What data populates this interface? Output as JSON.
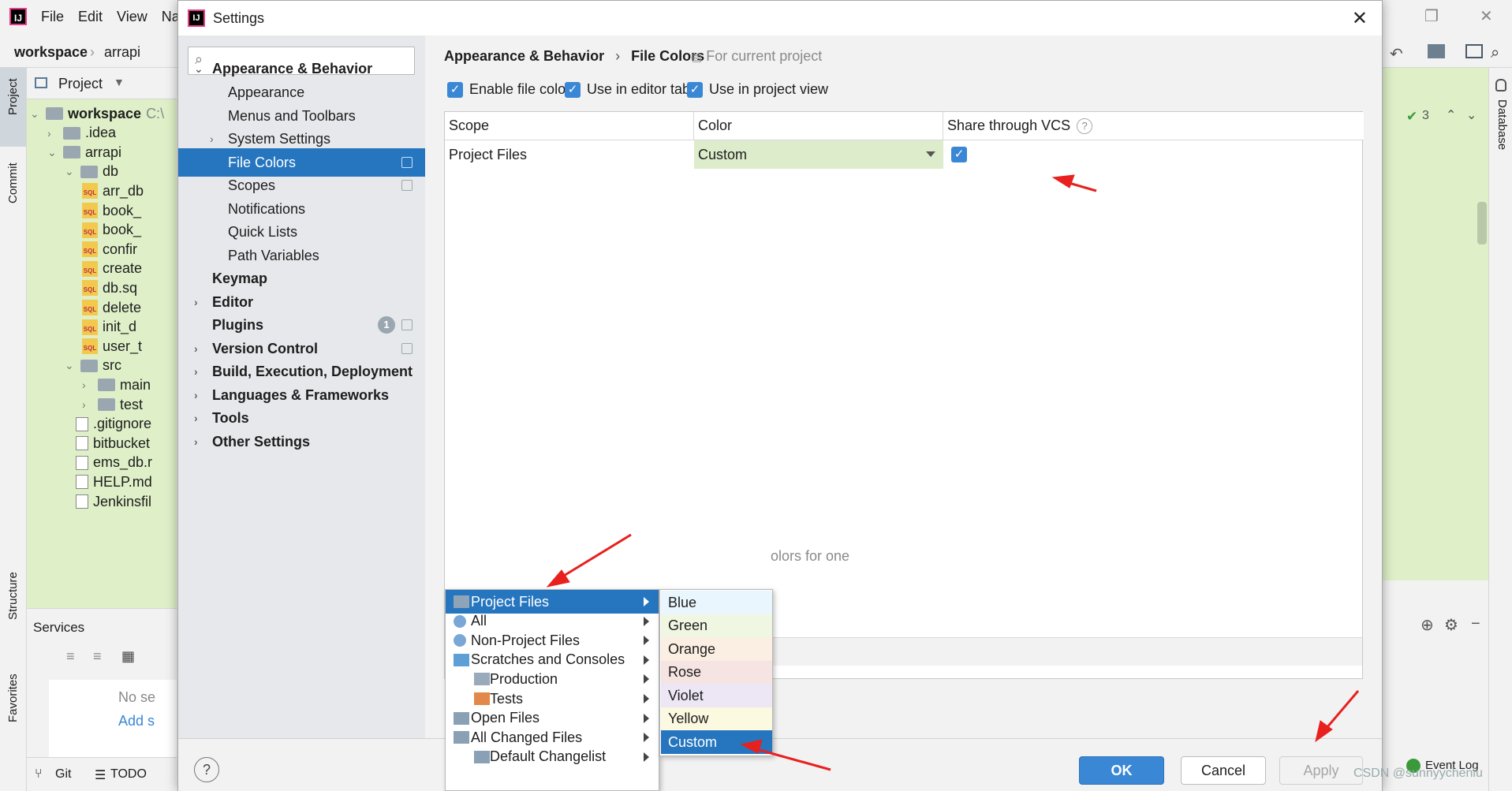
{
  "ide": {
    "menu": [
      "File",
      "Edit",
      "View",
      "Na"
    ],
    "breadcrumb": [
      "workspace",
      "arrapi"
    ],
    "project_header": "Project",
    "left_strip": [
      "Project",
      "Commit",
      "Structure",
      "Favorites"
    ],
    "right_strip": [
      "Database"
    ],
    "tree": [
      {
        "label": "workspace",
        "extra": "C:\\"
      },
      {
        "label": ".idea"
      },
      {
        "label": "arrapi"
      },
      {
        "label": "db"
      },
      {
        "label": "arr_db"
      },
      {
        "label": "book_"
      },
      {
        "label": "book_"
      },
      {
        "label": "confir"
      },
      {
        "label": "create"
      },
      {
        "label": "db.sq"
      },
      {
        "label": "delete"
      },
      {
        "label": "init_d"
      },
      {
        "label": "user_t"
      },
      {
        "label": "src"
      },
      {
        "label": "main"
      },
      {
        "label": "test"
      },
      {
        "label": ".gitignore"
      },
      {
        "label": "bitbucket"
      },
      {
        "label": "ems_db.r"
      },
      {
        "label": "HELP.md"
      },
      {
        "label": "Jenkinsfil"
      }
    ],
    "services_title": "Services",
    "services_empty": "No se",
    "services_add": "Add s",
    "bottom_tabs": [
      "Git",
      "TODO"
    ],
    "inspection_count": "3",
    "event_log": "Event Log"
  },
  "dialog": {
    "title": "Settings",
    "sidebar": [
      {
        "label": "Appearance & Behavior",
        "bold": true,
        "level": 0,
        "arrow": "down"
      },
      {
        "label": "Appearance",
        "level": 1
      },
      {
        "label": "Menus and Toolbars",
        "level": 1
      },
      {
        "label": "System Settings",
        "level": 1,
        "arrow": "right"
      },
      {
        "label": "File Colors",
        "level": 1,
        "selected": true,
        "cfg": true
      },
      {
        "label": "Scopes",
        "level": 1,
        "cfg": true
      },
      {
        "label": "Notifications",
        "level": 1
      },
      {
        "label": "Quick Lists",
        "level": 1
      },
      {
        "label": "Path Variables",
        "level": 1
      },
      {
        "label": "Keymap",
        "bold": true,
        "level": 0
      },
      {
        "label": "Editor",
        "bold": true,
        "level": 0,
        "arrow": "right"
      },
      {
        "label": "Plugins",
        "bold": true,
        "level": 0,
        "badge": "1",
        "cfg": true
      },
      {
        "label": "Version Control",
        "bold": true,
        "level": 0,
        "arrow": "right",
        "cfg": true
      },
      {
        "label": "Build, Execution, Deployment",
        "bold": true,
        "level": 0,
        "arrow": "right"
      },
      {
        "label": "Languages & Frameworks",
        "bold": true,
        "level": 0,
        "arrow": "right"
      },
      {
        "label": "Tools",
        "bold": true,
        "level": 0,
        "arrow": "right"
      },
      {
        "label": "Other Settings",
        "bold": true,
        "level": 0,
        "arrow": "right"
      }
    ],
    "breadcrumb": [
      "Appearance & Behavior",
      "File Colors"
    ],
    "for_current_project": "For current project",
    "checkboxes": {
      "enable_file_colors": "Enable file colors",
      "use_in_editor_tabs": "Use in editor tabs",
      "use_in_project_view": "Use in project view"
    },
    "table": {
      "headers": {
        "scope": "Scope",
        "color": "Color",
        "share": "Share through VCS"
      },
      "rows": [
        {
          "scope": "Project Files",
          "color": "Custom",
          "share": true
        }
      ]
    },
    "hint_fragment": "olors for one",
    "buttons": {
      "ok": "OK",
      "cancel": "Cancel",
      "apply": "Apply"
    }
  },
  "scope_menu": [
    {
      "label": "Project Files",
      "selected": true,
      "icon": "folder-icon",
      "indent": 0
    },
    {
      "label": "All",
      "icon": "scope-icon",
      "indent": 0
    },
    {
      "label": "Non-Project Files",
      "icon": "scope-icon",
      "indent": 0
    },
    {
      "label": "Scratches and Consoles",
      "icon": "scratches-icon",
      "indent": 0
    },
    {
      "label": "Production",
      "icon": "production-icon",
      "indent": 1
    },
    {
      "label": "Tests",
      "icon": "tests-icon",
      "indent": 1
    },
    {
      "label": "Open Files",
      "icon": "open-files-icon",
      "indent": 0
    },
    {
      "label": "All Changed Files",
      "icon": "changed-files-icon",
      "indent": 0
    },
    {
      "label": "Default Changelist",
      "icon": "changelist-icon",
      "indent": 1
    }
  ],
  "color_menu": [
    {
      "label": "Blue",
      "bg": "#eaf6fd"
    },
    {
      "label": "Green",
      "bg": "#eff7e3"
    },
    {
      "label": "Orange",
      "bg": "#fbeee2"
    },
    {
      "label": "Rose",
      "bg": "#f5e4e1"
    },
    {
      "label": "Violet",
      "bg": "#ece6f5"
    },
    {
      "label": "Yellow",
      "bg": "#fbf9e0"
    },
    {
      "label": "Custom",
      "bg": "#2675bf",
      "selected": true
    }
  ],
  "watermark": "CSDN @sunnyycheniu",
  "colors": {
    "accent": "#2675bf",
    "custom_cell": "#ddeccb",
    "annotation_arrow": "#e8201e",
    "project_tree_bg": "#dff0c8"
  }
}
